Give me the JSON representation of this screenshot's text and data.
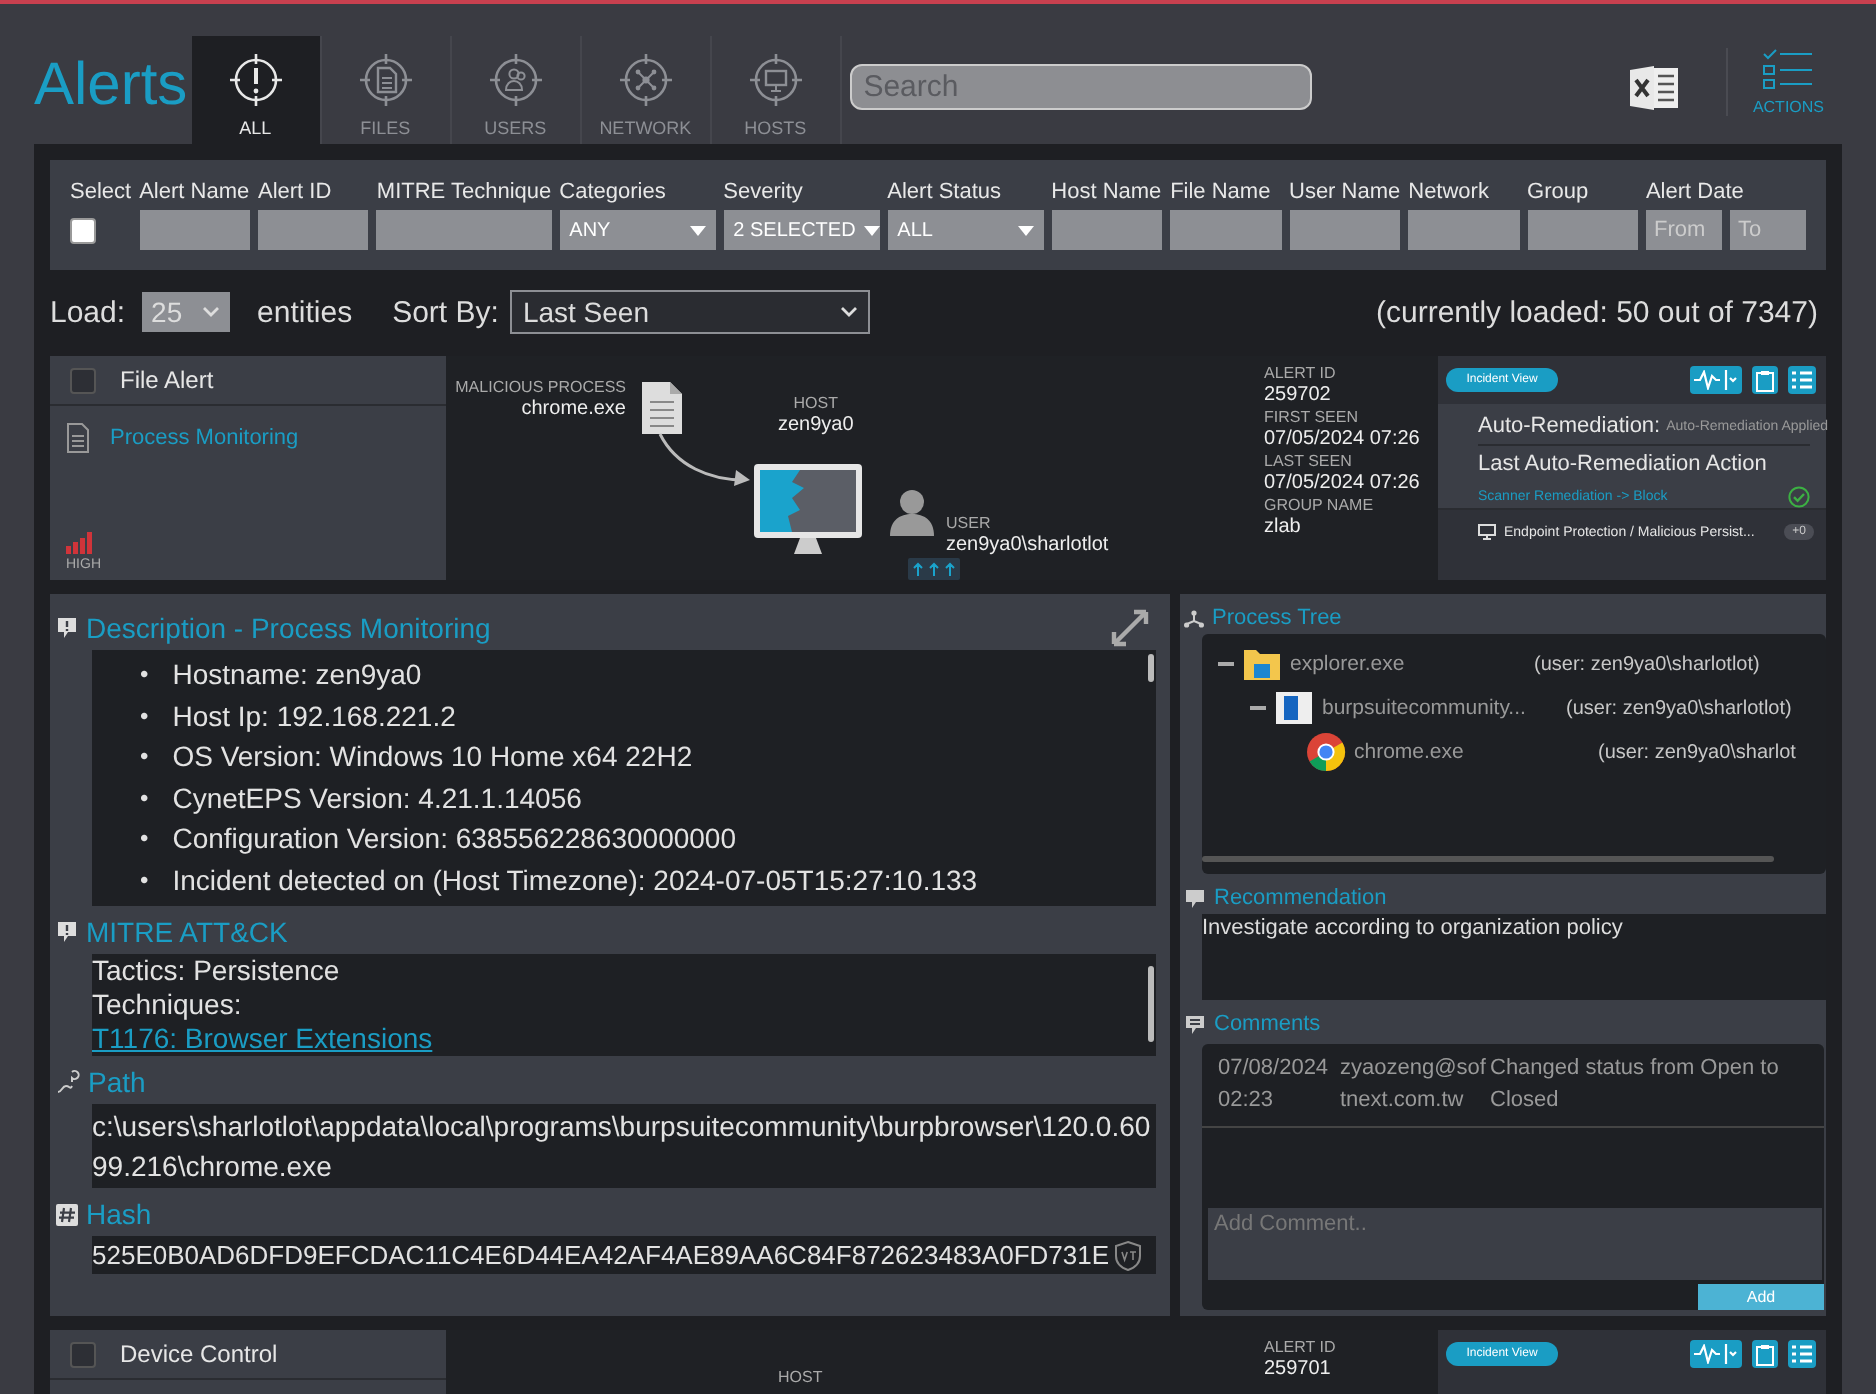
{
  "header": {
    "title": "Alerts",
    "tabs": [
      {
        "label": "ALL",
        "selected": true
      },
      {
        "label": "FILES",
        "selected": false
      },
      {
        "label": "USERS",
        "selected": false
      },
      {
        "label": "NETWORK",
        "selected": false
      },
      {
        "label": "HOSTS",
        "selected": false
      }
    ],
    "search": {
      "placeholder": "Search"
    },
    "actions_label": "ACTIONS"
  },
  "filters": [
    {
      "label": "Select",
      "kind": "checkbox",
      "checked": false
    },
    {
      "label": "Alert Name",
      "kind": "text"
    },
    {
      "label": "Alert ID",
      "kind": "text"
    },
    {
      "label": "MITRE Technique",
      "kind": "text"
    },
    {
      "label": "Categories",
      "kind": "select",
      "value": "ANY"
    },
    {
      "label": "Severity",
      "kind": "select",
      "value": "2 SELECTED"
    },
    {
      "label": "Alert Status",
      "kind": "select",
      "value": "ALL"
    },
    {
      "label": "Host Name",
      "kind": "text"
    },
    {
      "label": "File Name",
      "kind": "text"
    },
    {
      "label": "User Name",
      "kind": "text"
    },
    {
      "label": "Network",
      "kind": "text"
    },
    {
      "label": "Group",
      "kind": "text"
    },
    {
      "label": "Alert Date",
      "kind": "daterange",
      "from_placeholder": "From",
      "to_placeholder": "To"
    }
  ],
  "load_bar": {
    "load_label": "Load:",
    "load_value": "25",
    "entities_label": "entities",
    "sort_label": "Sort By:",
    "sort_value": "Last Seen",
    "loaded_summary": "(currently loaded: 50 out of 7347)"
  },
  "alerts": [
    {
      "checked": false,
      "type_label": "File Alert",
      "category": "Process Monitoring",
      "severity": "HIGH",
      "diagram": {
        "process_label": "MALICIOUS PROCESS",
        "process": "chrome.exe",
        "host_label": "HOST",
        "host": "zen9ya0",
        "user_label": "USER",
        "user": "zen9ya0\\sharlotlot"
      },
      "details": [
        {
          "label": "ALERT ID",
          "value": "259702"
        },
        {
          "label": "FIRST SEEN",
          "value": "07/05/2024 07:26"
        },
        {
          "label": "LAST SEEN",
          "value": "07/05/2024 07:26"
        },
        {
          "label": "GROUP NAME",
          "value": "zlab"
        }
      ],
      "incident_view": "Incident View",
      "remediation": {
        "label": "Auto-Remediation:",
        "status": "Auto-Remediation Applied",
        "action_label": "Last Auto-Remediation Action",
        "action": "Scanner Remediation -> Block",
        "done": true
      },
      "tag": "Endpoint Protection / Malicious Persist...",
      "tag_count": "+0"
    },
    {
      "checked": false,
      "type_label": "Device Control",
      "diagram": {
        "host_label": "HOST"
      },
      "details": [
        {
          "label": "ALERT ID",
          "value": "259701"
        }
      ],
      "incident_view": "Incident View"
    }
  ],
  "alert_detail": {
    "description": {
      "title": "Description - Process Monitoring",
      "bullet": "•",
      "items": [
        "Hostname: zen9ya0",
        "Host Ip: 192.168.221.2",
        "OS Version: Windows 10 Home x64 22H2",
        "CynetEPS Version: 4.21.1.14056",
        "Configuration Version: 638556228630000000",
        "Incident detected on (Host Timezone): 2024-07-05T15:27:10.133"
      ]
    },
    "mitre": {
      "title": "MITRE ATT&CK",
      "tactics": "Tactics: Persistence",
      "techniques_label": "Techniques:",
      "technique_link": "T1176: Browser Extensions"
    },
    "path": {
      "title": "Path",
      "value": "c:\\users\\sharlotlot\\appdata\\local\\programs\\burpsuitecommunity\\burpbrowser\\120.0.6099.216\\chrome.exe"
    },
    "hash": {
      "title": "Hash",
      "value": "525E0B0AD6DFD9EFCDAC11C4E6D44EA42AF4AE89AA6C84F872623483A0FD731E"
    },
    "process_tree": {
      "title": "Process Tree",
      "nodes": [
        {
          "name": "explorer.exe",
          "user": "(user: zen9ya0\\sharlotlot)",
          "expanded": true,
          "children": [
            {
              "name": "burpsuitecommunity...",
              "user": "(user: zen9ya0\\sharlotlot)",
              "expanded": true,
              "children": [
                {
                  "name": "chrome.exe",
                  "user": "(user: zen9ya0\\sharlot"
                }
              ]
            }
          ]
        }
      ]
    },
    "recommendation": {
      "title": "Recommendation",
      "text": "Investigate according to organization policy"
    },
    "comments": {
      "title": "Comments",
      "entries": [
        {
          "date": "07/08/2024 02:23",
          "user": "zyaozeng@softnext.com.tw",
          "text": "Changed status from Open to Closed"
        }
      ],
      "placeholder": "Add Comment..",
      "add_button": "Add"
    }
  }
}
